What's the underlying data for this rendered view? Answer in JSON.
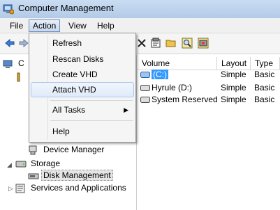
{
  "window": {
    "title": "Computer Management"
  },
  "menubar": {
    "items": [
      {
        "label": "File"
      },
      {
        "label": "Action"
      },
      {
        "label": "View"
      },
      {
        "label": "Help"
      }
    ]
  },
  "action_menu": {
    "items": [
      {
        "label": "Refresh"
      },
      {
        "label": "Rescan Disks"
      },
      {
        "label": "Create VHD"
      },
      {
        "label": "Attach VHD"
      },
      {
        "label": "All Tasks",
        "submenu_arrow": "▶"
      },
      {
        "label": "Help"
      }
    ]
  },
  "tree": {
    "root_label_partial": "C",
    "items": [
      {
        "label": "Device Manager"
      },
      {
        "label": "Storage"
      },
      {
        "label": "Disk Management"
      },
      {
        "label": "Services and Applications"
      }
    ]
  },
  "volume_list": {
    "columns": [
      "Volume",
      "Layout",
      "Type"
    ],
    "rows": [
      {
        "volume": "(C:)",
        "layout": "Simple",
        "type": "Basic"
      },
      {
        "volume": "Hyrule (D:)",
        "layout": "Simple",
        "type": "Basic"
      },
      {
        "volume": "System Reserved",
        "layout": "Simple",
        "type": "Basic"
      }
    ]
  },
  "colors": {
    "selection": "#3399ff",
    "title_bar": "#c9dcf2"
  }
}
